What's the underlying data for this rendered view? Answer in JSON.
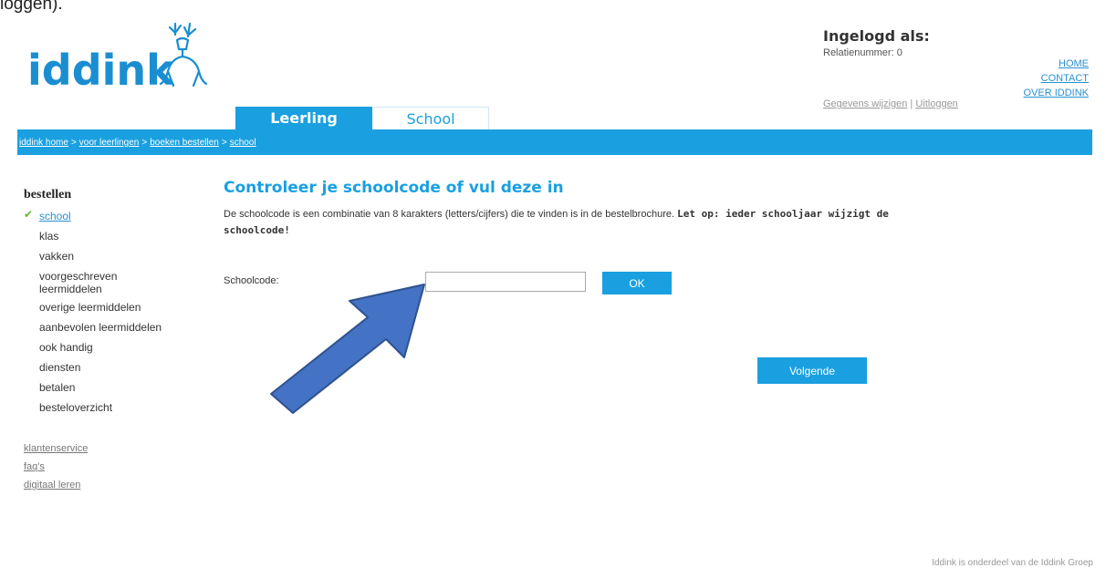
{
  "top_fragment": "loggen).",
  "brand": {
    "name": "iddink"
  },
  "login": {
    "title": "Ingelogd als:",
    "relation": "Relatienummer: 0",
    "edit_link": "Gegevens wijzigen",
    "separator": "|",
    "logout_link": "Uitloggen"
  },
  "right_nav": {
    "home": "HOME",
    "contact": "CONTACT",
    "about": "OVER IDDINK"
  },
  "tabs": {
    "active": "Leerling",
    "inactive": "School"
  },
  "breadcrumb": {
    "separator": ">",
    "items": [
      "iddink home",
      "voor leerlingen",
      "boeken bestellen",
      "school"
    ]
  },
  "sidebar": {
    "title": "bestellen",
    "items": [
      {
        "label": "school",
        "checked": true
      },
      {
        "label": "klas"
      },
      {
        "label": "vakken"
      },
      {
        "label": "voorgeschreven leermiddelen"
      },
      {
        "label": "overige leermiddelen"
      },
      {
        "label": "aanbevolen leermiddelen"
      },
      {
        "label": "ook handig"
      },
      {
        "label": "diensten"
      },
      {
        "label": "betalen"
      },
      {
        "label": "besteloverzicht"
      }
    ],
    "check_mark": "✔",
    "links": [
      "klantenservice",
      "faq's",
      "digitaal leren"
    ]
  },
  "main": {
    "title": "Controleer je schoolcode of vul deze in",
    "description": "De schoolcode is een combinatie van 8 karakters (letters/cijfers) die te vinden is in de bestelbrochure.",
    "warning": "Let op: ieder schooljaar wijzigt de schoolcode!",
    "code_label": "Schoolcode:",
    "code_value": "",
    "ok_label": "OK",
    "next_label": "Volgende"
  },
  "annotation": {
    "arrow_color": "#4472c4",
    "arrow_border": "#2f528f"
  },
  "footer": "Iddink is onderdeel van de Iddink Groep",
  "colors": {
    "accent": "#1aa0e0",
    "brand": "#1a8ed1",
    "check": "#6cb33f"
  }
}
